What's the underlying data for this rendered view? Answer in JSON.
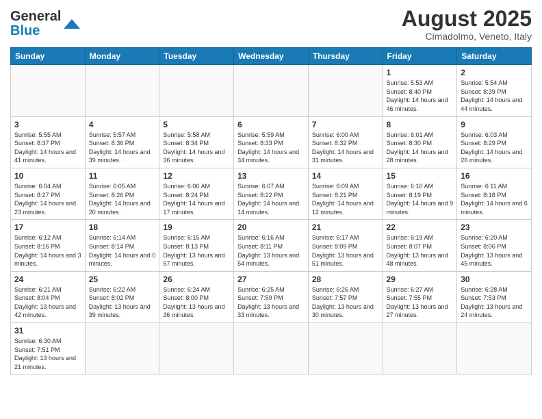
{
  "header": {
    "logo_general": "General",
    "logo_blue": "Blue",
    "month_year": "August 2025",
    "location": "Cimadolmo, Veneto, Italy"
  },
  "days_of_week": [
    "Sunday",
    "Monday",
    "Tuesday",
    "Wednesday",
    "Thursday",
    "Friday",
    "Saturday"
  ],
  "weeks": [
    [
      {
        "day": "",
        "info": ""
      },
      {
        "day": "",
        "info": ""
      },
      {
        "day": "",
        "info": ""
      },
      {
        "day": "",
        "info": ""
      },
      {
        "day": "",
        "info": ""
      },
      {
        "day": "1",
        "info": "Sunrise: 5:53 AM\nSunset: 8:40 PM\nDaylight: 14 hours and 46 minutes."
      },
      {
        "day": "2",
        "info": "Sunrise: 5:54 AM\nSunset: 8:39 PM\nDaylight: 14 hours and 44 minutes."
      }
    ],
    [
      {
        "day": "3",
        "info": "Sunrise: 5:55 AM\nSunset: 8:37 PM\nDaylight: 14 hours and 41 minutes."
      },
      {
        "day": "4",
        "info": "Sunrise: 5:57 AM\nSunset: 8:36 PM\nDaylight: 14 hours and 39 minutes."
      },
      {
        "day": "5",
        "info": "Sunrise: 5:58 AM\nSunset: 8:34 PM\nDaylight: 14 hours and 36 minutes."
      },
      {
        "day": "6",
        "info": "Sunrise: 5:59 AM\nSunset: 8:33 PM\nDaylight: 14 hours and 34 minutes."
      },
      {
        "day": "7",
        "info": "Sunrise: 6:00 AM\nSunset: 8:32 PM\nDaylight: 14 hours and 31 minutes."
      },
      {
        "day": "8",
        "info": "Sunrise: 6:01 AM\nSunset: 8:30 PM\nDaylight: 14 hours and 28 minutes."
      },
      {
        "day": "9",
        "info": "Sunrise: 6:03 AM\nSunset: 8:29 PM\nDaylight: 14 hours and 26 minutes."
      }
    ],
    [
      {
        "day": "10",
        "info": "Sunrise: 6:04 AM\nSunset: 8:27 PM\nDaylight: 14 hours and 23 minutes."
      },
      {
        "day": "11",
        "info": "Sunrise: 6:05 AM\nSunset: 8:26 PM\nDaylight: 14 hours and 20 minutes."
      },
      {
        "day": "12",
        "info": "Sunrise: 6:06 AM\nSunset: 8:24 PM\nDaylight: 14 hours and 17 minutes."
      },
      {
        "day": "13",
        "info": "Sunrise: 6:07 AM\nSunset: 8:22 PM\nDaylight: 14 hours and 14 minutes."
      },
      {
        "day": "14",
        "info": "Sunrise: 6:09 AM\nSunset: 8:21 PM\nDaylight: 14 hours and 12 minutes."
      },
      {
        "day": "15",
        "info": "Sunrise: 6:10 AM\nSunset: 8:19 PM\nDaylight: 14 hours and 9 minutes."
      },
      {
        "day": "16",
        "info": "Sunrise: 6:11 AM\nSunset: 8:18 PM\nDaylight: 14 hours and 6 minutes."
      }
    ],
    [
      {
        "day": "17",
        "info": "Sunrise: 6:12 AM\nSunset: 8:16 PM\nDaylight: 14 hours and 3 minutes."
      },
      {
        "day": "18",
        "info": "Sunrise: 6:14 AM\nSunset: 8:14 PM\nDaylight: 14 hours and 0 minutes."
      },
      {
        "day": "19",
        "info": "Sunrise: 6:15 AM\nSunset: 8:13 PM\nDaylight: 13 hours and 57 minutes."
      },
      {
        "day": "20",
        "info": "Sunrise: 6:16 AM\nSunset: 8:11 PM\nDaylight: 13 hours and 54 minutes."
      },
      {
        "day": "21",
        "info": "Sunrise: 6:17 AM\nSunset: 8:09 PM\nDaylight: 13 hours and 51 minutes."
      },
      {
        "day": "22",
        "info": "Sunrise: 6:19 AM\nSunset: 8:07 PM\nDaylight: 13 hours and 48 minutes."
      },
      {
        "day": "23",
        "info": "Sunrise: 6:20 AM\nSunset: 8:06 PM\nDaylight: 13 hours and 45 minutes."
      }
    ],
    [
      {
        "day": "24",
        "info": "Sunrise: 6:21 AM\nSunset: 8:04 PM\nDaylight: 13 hours and 42 minutes."
      },
      {
        "day": "25",
        "info": "Sunrise: 6:22 AM\nSunset: 8:02 PM\nDaylight: 13 hours and 39 minutes."
      },
      {
        "day": "26",
        "info": "Sunrise: 6:24 AM\nSunset: 8:00 PM\nDaylight: 13 hours and 36 minutes."
      },
      {
        "day": "27",
        "info": "Sunrise: 6:25 AM\nSunset: 7:59 PM\nDaylight: 13 hours and 33 minutes."
      },
      {
        "day": "28",
        "info": "Sunrise: 6:26 AM\nSunset: 7:57 PM\nDaylight: 13 hours and 30 minutes."
      },
      {
        "day": "29",
        "info": "Sunrise: 6:27 AM\nSunset: 7:55 PM\nDaylight: 13 hours and 27 minutes."
      },
      {
        "day": "30",
        "info": "Sunrise: 6:28 AM\nSunset: 7:53 PM\nDaylight: 13 hours and 24 minutes."
      }
    ],
    [
      {
        "day": "31",
        "info": "Sunrise: 6:30 AM\nSunset: 7:51 PM\nDaylight: 13 hours and 21 minutes."
      },
      {
        "day": "",
        "info": ""
      },
      {
        "day": "",
        "info": ""
      },
      {
        "day": "",
        "info": ""
      },
      {
        "day": "",
        "info": ""
      },
      {
        "day": "",
        "info": ""
      },
      {
        "day": "",
        "info": ""
      }
    ]
  ]
}
